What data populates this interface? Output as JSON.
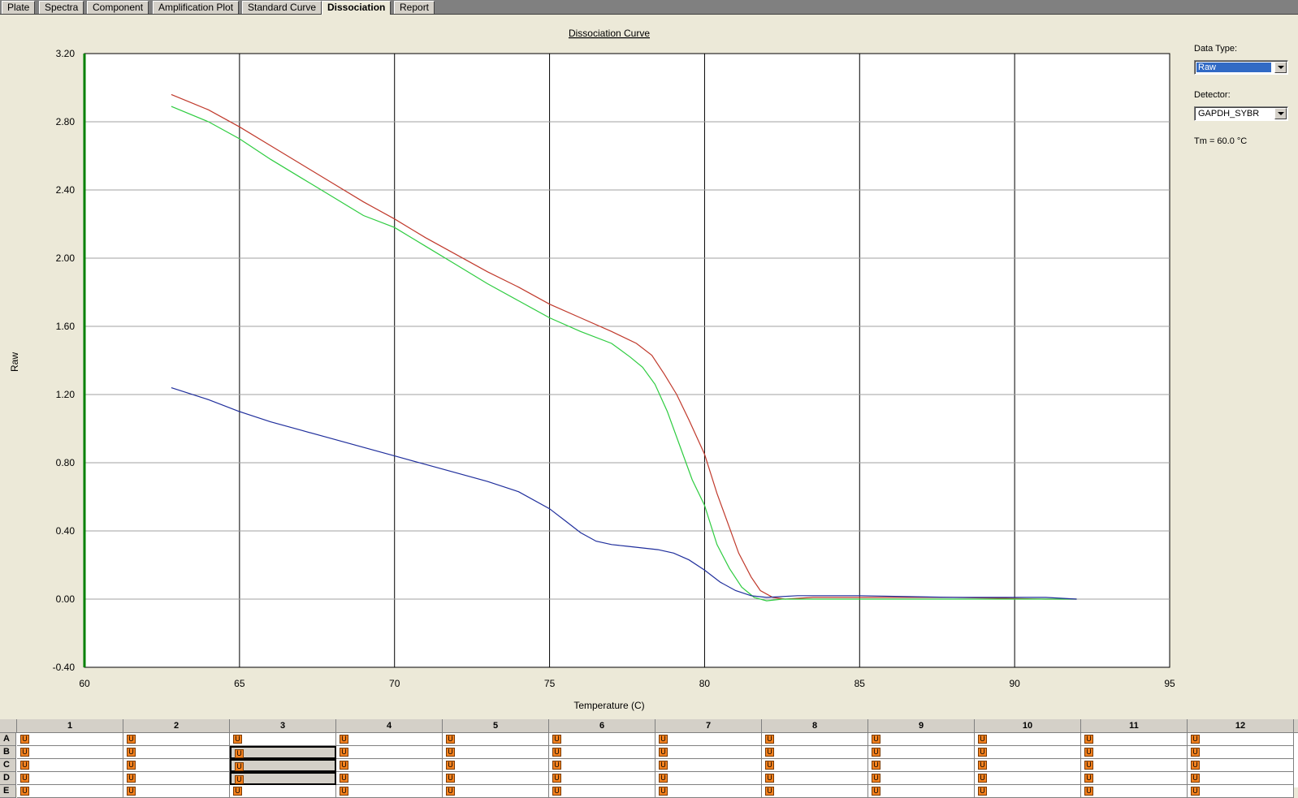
{
  "tabs": [
    {
      "label": "Plate",
      "active": false
    },
    {
      "label": "Spectra",
      "active": false
    },
    {
      "label": "Component",
      "active": false
    },
    {
      "label": "Amplification Plot",
      "active": false
    },
    {
      "label": "Standard Curve",
      "active": false
    },
    {
      "label": "Dissociation",
      "active": true
    },
    {
      "label": "Report",
      "active": false
    }
  ],
  "side_panel": {
    "data_type_label": "Data Type:",
    "data_type_value": "Raw",
    "detector_label": "Detector:",
    "detector_value": "GAPDH_SYBR",
    "tm_text": "Tm = 60.0 °C"
  },
  "chart_data": {
    "type": "line",
    "title": "Dissociation Curve",
    "xlabel": "Temperature (C)",
    "ylabel": "Raw",
    "xlim": [
      60,
      95
    ],
    "ylim": [
      -0.4,
      3.2
    ],
    "x_ticks": [
      "60",
      "65",
      "70",
      "75",
      "80",
      "85",
      "90",
      "95"
    ],
    "y_ticks": [
      "-0.40",
      "0.00",
      "0.40",
      "0.80",
      "1.20",
      "1.60",
      "2.00",
      "2.40",
      "2.80",
      "3.20"
    ],
    "grid": "on",
    "tm_marker_x": 60.0,
    "tm_marker_color": "#008000",
    "series": [
      {
        "color": "#c0392b",
        "x": [
          62.8,
          64.0,
          65.0,
          66.0,
          67.0,
          68.0,
          69.0,
          70.0,
          71.0,
          72.0,
          73.0,
          74.0,
          75.0,
          76.0,
          77.0,
          77.8,
          78.3,
          78.7,
          79.1,
          79.5,
          80.0,
          80.4,
          80.8,
          81.1,
          81.5,
          81.8,
          82.2,
          82.6,
          83.5,
          85.0,
          88.0,
          91.0,
          92.0
        ],
        "y": [
          2.96,
          2.87,
          2.77,
          2.66,
          2.55,
          2.44,
          2.33,
          2.23,
          2.12,
          2.02,
          1.92,
          1.83,
          1.73,
          1.65,
          1.57,
          1.5,
          1.43,
          1.32,
          1.2,
          1.05,
          0.85,
          0.62,
          0.42,
          0.27,
          0.13,
          0.05,
          0.01,
          0.0,
          0.01,
          0.01,
          0.01,
          0.0,
          0.0
        ]
      },
      {
        "color": "#2ecc40",
        "x": [
          62.8,
          64.0,
          65.0,
          66.0,
          67.0,
          68.0,
          69.0,
          70.0,
          71.0,
          72.0,
          73.0,
          74.0,
          75.0,
          76.0,
          77.0,
          77.6,
          78.0,
          78.4,
          78.8,
          79.2,
          79.6,
          80.0,
          80.4,
          80.8,
          81.2,
          81.6,
          82.0,
          82.5,
          84.0,
          87.0,
          90.0,
          92.0
        ],
        "y": [
          2.89,
          2.8,
          2.7,
          2.58,
          2.47,
          2.36,
          2.25,
          2.18,
          2.07,
          1.96,
          1.85,
          1.75,
          1.65,
          1.57,
          1.5,
          1.42,
          1.36,
          1.26,
          1.1,
          0.9,
          0.7,
          0.55,
          0.32,
          0.18,
          0.07,
          0.01,
          -0.01,
          0.0,
          0.0,
          0.0,
          0.0,
          0.0
        ]
      },
      {
        "color": "#1f2e9c",
        "x": [
          62.8,
          64.0,
          65.0,
          66.0,
          67.0,
          68.0,
          69.0,
          70.0,
          71.0,
          72.0,
          73.0,
          74.0,
          75.0,
          75.5,
          76.0,
          76.5,
          77.0,
          77.5,
          78.0,
          78.5,
          79.0,
          79.5,
          80.0,
          80.5,
          81.0,
          81.5,
          82.0,
          83.0,
          85.0,
          88.0,
          91.0,
          92.0
        ],
        "y": [
          1.24,
          1.17,
          1.1,
          1.04,
          0.99,
          0.94,
          0.89,
          0.84,
          0.79,
          0.74,
          0.69,
          0.63,
          0.53,
          0.46,
          0.39,
          0.34,
          0.32,
          0.31,
          0.3,
          0.29,
          0.27,
          0.23,
          0.17,
          0.1,
          0.05,
          0.02,
          0.01,
          0.02,
          0.02,
          0.01,
          0.01,
          0.0
        ]
      }
    ]
  },
  "plate": {
    "columns": [
      "1",
      "2",
      "3",
      "4",
      "5",
      "6",
      "7",
      "8",
      "9",
      "10",
      "11",
      "12"
    ],
    "rows": [
      "A",
      "B",
      "C",
      "D",
      "E"
    ],
    "well_marker": "U",
    "selected_wells": [
      "B3",
      "C3",
      "D3"
    ]
  }
}
